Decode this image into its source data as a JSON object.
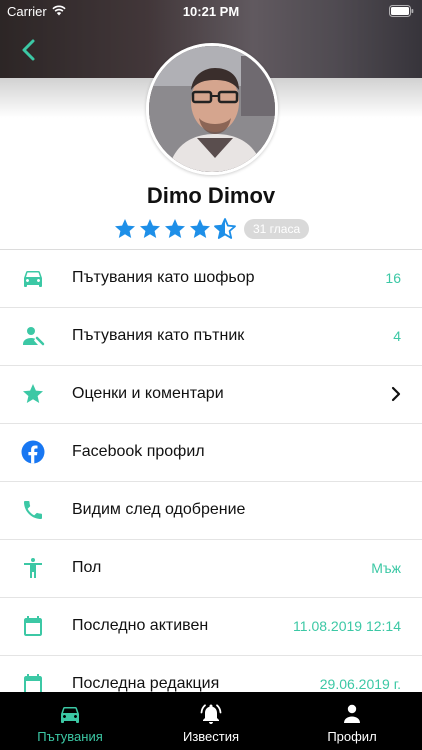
{
  "status_bar": {
    "carrier": "Carrier",
    "time": "10:21 PM"
  },
  "header": {
    "back_icon": "chevron-left-icon"
  },
  "profile": {
    "name": "Dimo Dimov",
    "rating": 4.5,
    "rating_max": 5,
    "votes": "31 гласа"
  },
  "menu": {
    "items": [
      {
        "icon": "car-icon",
        "label": "Пътувания като шофьор",
        "value": "16"
      },
      {
        "icon": "person-icon",
        "label": "Пътувания като пътник",
        "value": "4"
      },
      {
        "icon": "star-icon",
        "label": "Оценки и коментари",
        "value": ""
      },
      {
        "icon": "facebook-icon",
        "label": "Facebook профил",
        "value": ""
      },
      {
        "icon": "phone-icon",
        "label": "Видим след одобрение",
        "value": ""
      },
      {
        "icon": "accessibility-icon",
        "label": "Пол",
        "value": "Мъж"
      },
      {
        "icon": "calendar-icon",
        "label": "Последно активен",
        "value": "11.08.2019 12:14"
      },
      {
        "icon": "calendar-icon",
        "label": "Последна редакция",
        "value": "29.06.2019 г."
      }
    ]
  },
  "tabs": [
    {
      "icon": "car-icon",
      "label": "Пътувания",
      "active": true
    },
    {
      "icon": "bell-icon",
      "label": "Известия",
      "active": false
    },
    {
      "icon": "person-icon",
      "label": "Профил",
      "active": false
    }
  ],
  "colors": {
    "accent": "#3cc8a5",
    "star": "#1e8fe8",
    "facebook": "#1877f2",
    "tab_bar": "#000000"
  }
}
